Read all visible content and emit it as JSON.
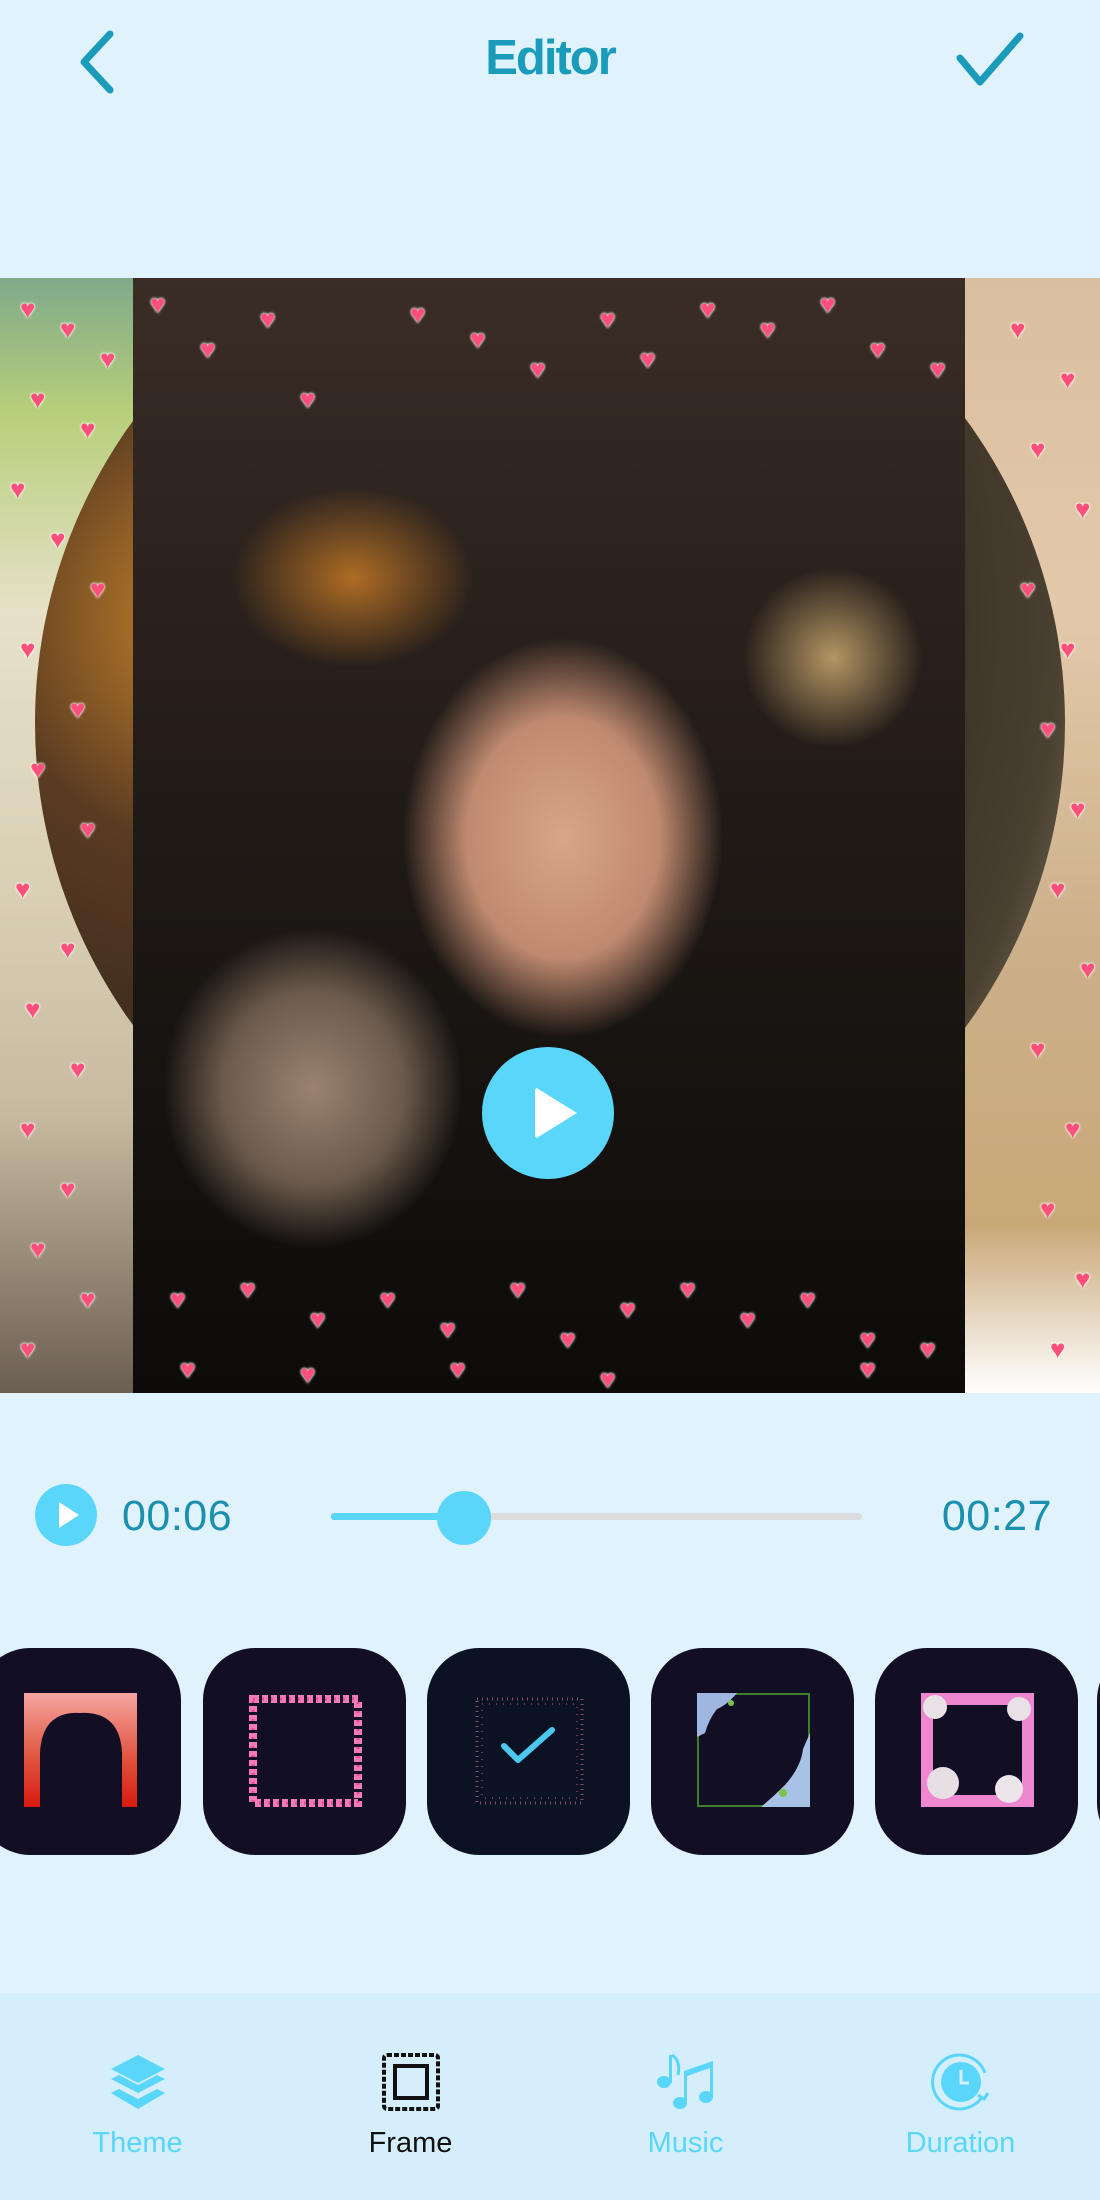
{
  "header": {
    "title": "Editor",
    "back_icon": "chevron-left-icon",
    "done_icon": "check-icon"
  },
  "preview": {
    "play_icon": "play-icon"
  },
  "player": {
    "current_time": "00:06",
    "total_time": "00:27",
    "progress_percent": 25
  },
  "frames": {
    "items": [
      {
        "name": "fire-arch-frame",
        "selected": false
      },
      {
        "name": "pink-hearts-frame",
        "selected": false
      },
      {
        "name": "sparkle-dots-frame",
        "selected": true
      },
      {
        "name": "blue-hydrangea-frame",
        "selected": false
      },
      {
        "name": "pink-orchid-frame",
        "selected": false
      }
    ]
  },
  "bottom_nav": {
    "items": [
      {
        "label": "Theme",
        "icon": "layers-icon",
        "active": false
      },
      {
        "label": "Frame",
        "icon": "frame-icon",
        "active": true
      },
      {
        "label": "Music",
        "icon": "music-notes-icon",
        "active": false
      },
      {
        "label": "Duration",
        "icon": "clock-icon",
        "active": false
      }
    ]
  },
  "colors": {
    "accent": "#5ad6fb",
    "title": "#1a9bba",
    "background": "#e0f3fd",
    "nav_background": "#d4effb",
    "thumb_background": "#120f25"
  }
}
